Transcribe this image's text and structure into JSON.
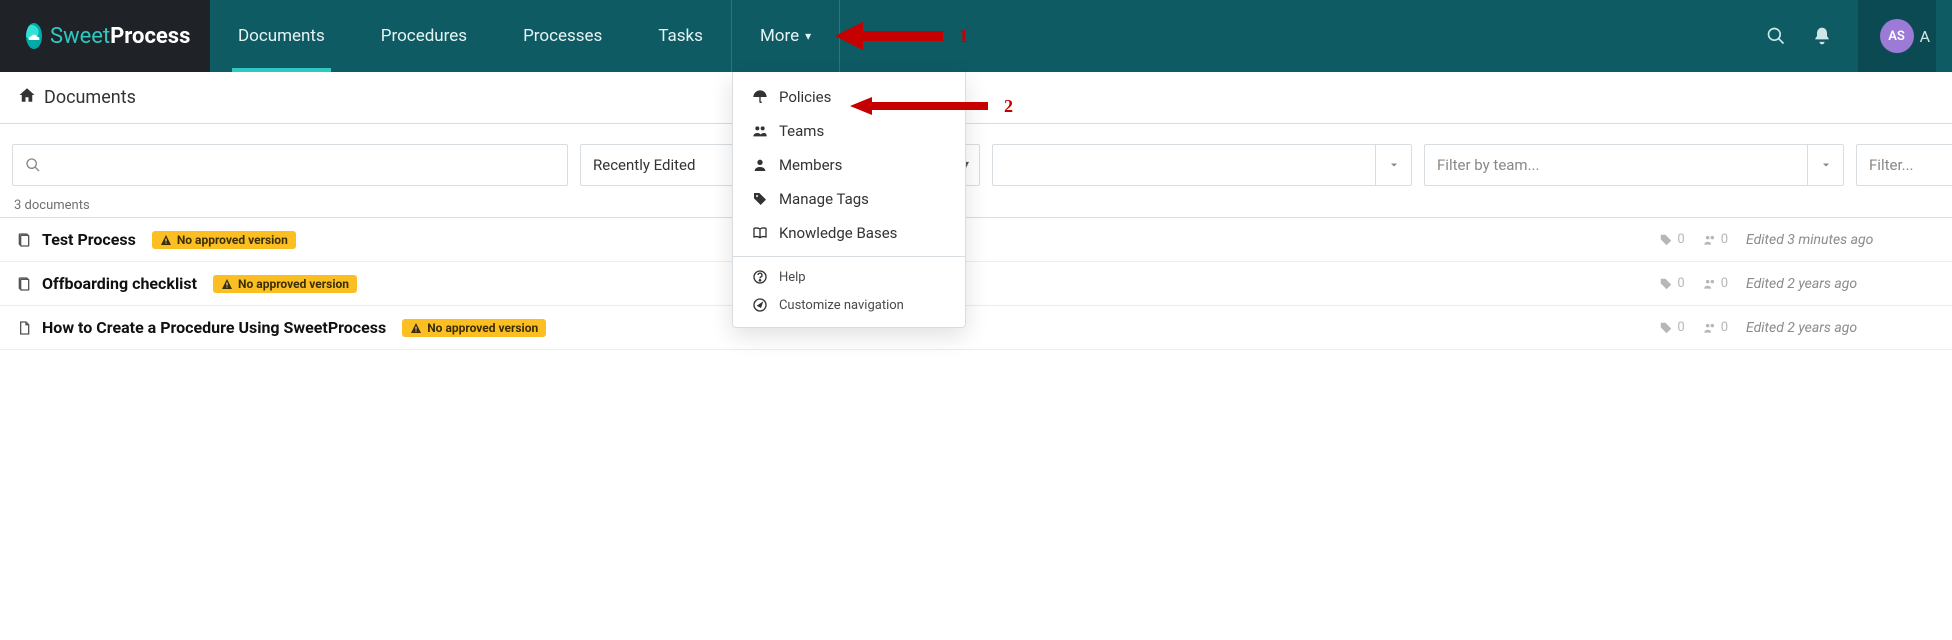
{
  "brand": {
    "sweet": "Sweet",
    "process": "Process"
  },
  "nav": {
    "items": [
      {
        "label": "Documents",
        "active": true
      },
      {
        "label": "Procedures"
      },
      {
        "label": "Processes"
      },
      {
        "label": "Tasks"
      },
      {
        "label": "More"
      }
    ],
    "avatar_initials": "AS",
    "user_name_initial": "A"
  },
  "more_menu": {
    "items": [
      {
        "icon": "umbrella",
        "label": "Policies"
      },
      {
        "icon": "users",
        "label": "Teams"
      },
      {
        "icon": "person",
        "label": "Members"
      },
      {
        "icon": "tag",
        "label": "Manage Tags"
      },
      {
        "icon": "book",
        "label": "Knowledge Bases"
      }
    ],
    "secondary": [
      {
        "icon": "help",
        "label": "Help"
      },
      {
        "icon": "compass",
        "label": "Customize navigation"
      }
    ]
  },
  "annotations": {
    "one": "1",
    "two": "2"
  },
  "breadcrumb": {
    "label": "Documents"
  },
  "filters": {
    "search_placeholder": "",
    "sort_value": "Recently Edited",
    "tag_placeholder": "",
    "team_placeholder": "Filter by team...",
    "procstate_placeholder": "Filter..."
  },
  "list": {
    "count_label": "3 documents",
    "badge_label": "No approved version",
    "rows": [
      {
        "title": "Test Process",
        "tags": "0",
        "teams": "0",
        "edited": "Edited 3 minutes ago"
      },
      {
        "title": "Offboarding checklist",
        "tags": "0",
        "teams": "0",
        "edited": "Edited 2 years ago"
      },
      {
        "title": "How to Create a Procedure Using SweetProcess",
        "tags": "0",
        "teams": "0",
        "edited": "Edited 2 years ago"
      }
    ]
  }
}
